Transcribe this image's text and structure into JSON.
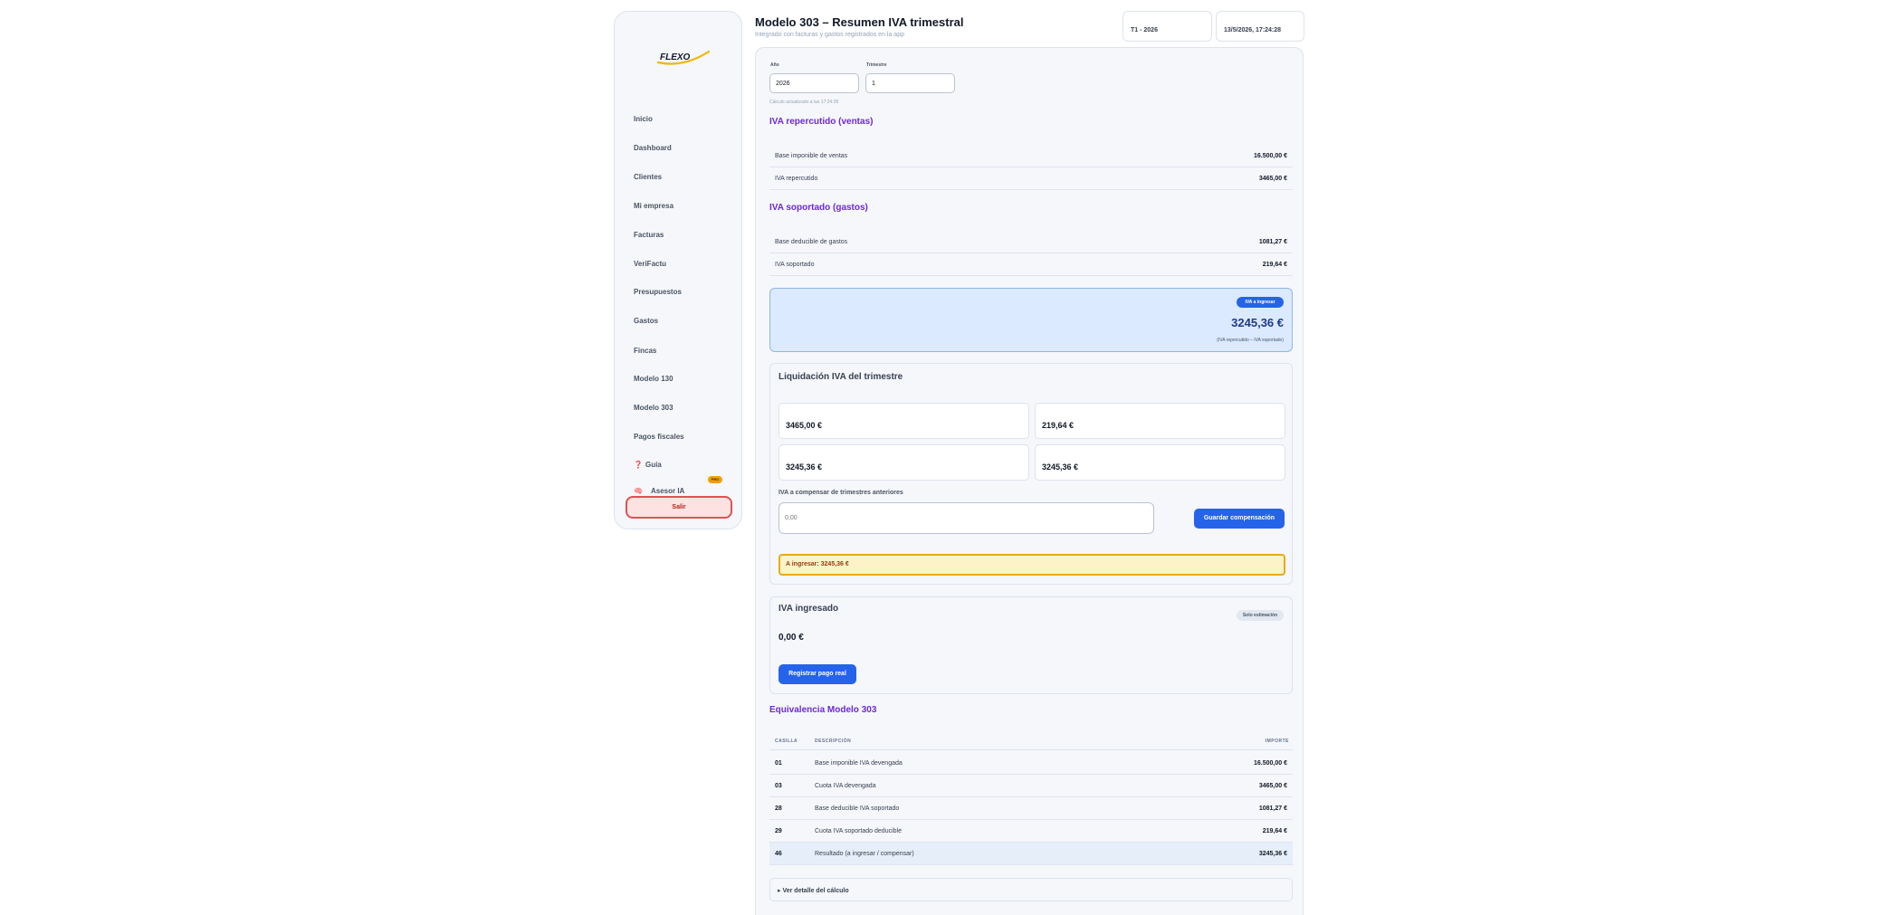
{
  "colors": {
    "accent": "#2563eb",
    "heading_purple": "#6d28d9",
    "danger": "#e05252",
    "warning": "#e6ac14",
    "result_bg": "#dbeafe"
  },
  "sidebar": {
    "logo_text": "FLEXO",
    "items": [
      {
        "label": "Inicio"
      },
      {
        "label": "Dashboard"
      },
      {
        "label": "Clientes"
      },
      {
        "label": "Mi empresa"
      },
      {
        "label": "Facturas"
      },
      {
        "label": "VeriFactu"
      },
      {
        "label": "Presupuestos"
      },
      {
        "label": "Gastos"
      },
      {
        "label": "Fincas"
      },
      {
        "label": "Modelo 130"
      },
      {
        "label": "Modelo 303"
      },
      {
        "label": "Pagos fiscales"
      },
      {
        "label": "Guía",
        "icon": "question-icon",
        "glyph": "❓"
      },
      {
        "label": "Asesor IA",
        "icon": "brain-icon",
        "glyph": "🧠",
        "badge": "PRO"
      }
    ],
    "logout_label": "Salir"
  },
  "header": {
    "title": "Modelo 303 – Resumen IVA trimestral",
    "subtitle": "Integrado con facturas y gastos registrados en la app",
    "period_label": "",
    "period_value": "T1 - 2026",
    "updated_label": "",
    "updated_value": "13/5/2026, 17:24:28"
  },
  "filters": {
    "year_label": "Año",
    "year_value": "2026",
    "quarter_label": "Trimestre",
    "quarter_value": "1",
    "calc_note": "Cálculo actualizado a las 17:24:28"
  },
  "iva_repercutido": {
    "heading": "IVA repercutido (ventas)",
    "rows": [
      {
        "label": "Base imponible de ventas",
        "value": "16.500,00 €"
      },
      {
        "label": "IVA repercutido",
        "value": "3465,00 €"
      }
    ]
  },
  "iva_soportado": {
    "heading": "IVA soportado (gastos)",
    "rows": [
      {
        "label": "Base deducible de gastos",
        "value": "1081,27 €"
      },
      {
        "label": "IVA soportado",
        "value": "219,64 €"
      }
    ]
  },
  "result": {
    "badge": "IVA a ingresar",
    "amount": "3245,36 €",
    "note": "(IVA repercutido – IVA soportado)"
  },
  "liquidacion": {
    "title": "Liquidación IVA del trimestre",
    "description": "",
    "stats": [
      {
        "label": "",
        "value": "3465,00 €"
      },
      {
        "label": "",
        "value": "219,64 €"
      },
      {
        "label": "",
        "value": "3245,36 €"
      },
      {
        "label": "",
        "value": "3245,36 €"
      }
    ],
    "compensation_label": "IVA a compensar de trimestres anteriores",
    "compensation_placeholder": "0,00",
    "save_button": "Guardar compensación",
    "to_pay": "A ingresar: 3245,36 €"
  },
  "iva_ingresado": {
    "title": "IVA ingresado",
    "description": "",
    "badge": "Solo estimación",
    "amount": "0,00 €",
    "note": "",
    "register_button": "Registrar pago real"
  },
  "equivalencia": {
    "heading": "Equivalencia Modelo 303",
    "columns": [
      "CASILLA",
      "DESCRIPCIÓN",
      "IMPORTE"
    ],
    "rows": [
      {
        "box": "01",
        "description": "Base imponible IVA devengada",
        "amount": "16.500,00 €"
      },
      {
        "box": "03",
        "description": "Cuota IVA devengada",
        "amount": "3465,00 €"
      },
      {
        "box": "28",
        "description": "Base deducible IVA soportado",
        "amount": "1081,27 €"
      },
      {
        "box": "29",
        "description": "Cuota IVA soportado deducible",
        "amount": "219,64 €"
      },
      {
        "box": "46",
        "description": "Resultado (a ingresar / compensar)",
        "amount": "3245,36 €"
      }
    ]
  },
  "details_toggle": "▸ Ver detalle del cálculo",
  "footer_note": ""
}
